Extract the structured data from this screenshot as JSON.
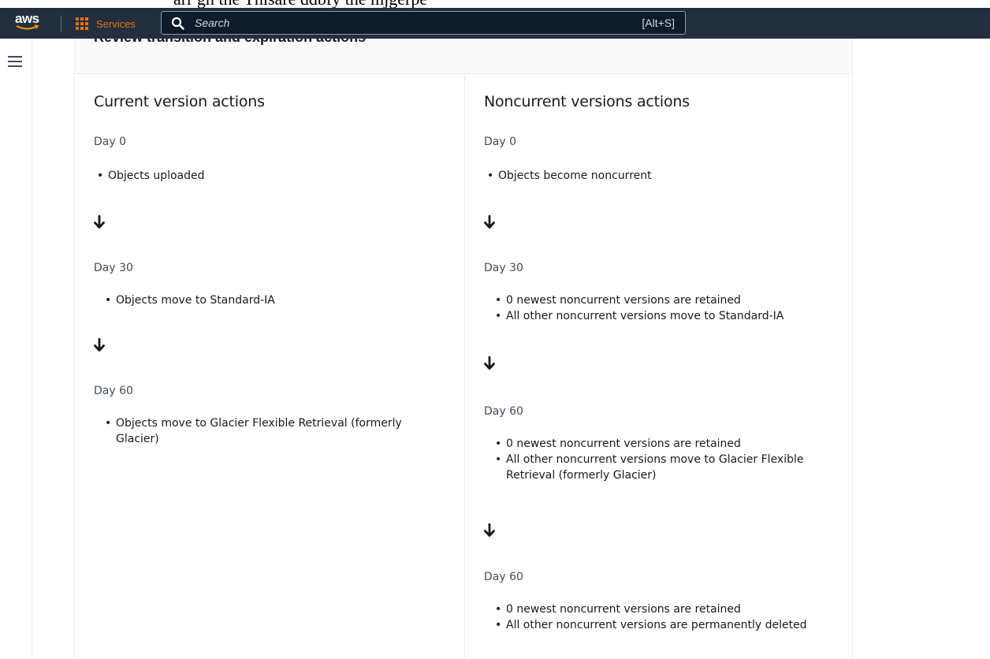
{
  "doc_strip_text": "arr gh  the   Thisare   ddbfy  the  mjgerpe",
  "nav": {
    "logo_text": "aws",
    "services_label": "Services",
    "search_placeholder": "Search",
    "search_shortcut": "[Alt+S]"
  },
  "panel": {
    "title": "Review transition and expiration actions"
  },
  "current": {
    "title": "Current version actions",
    "steps": [
      {
        "day": "Day 0",
        "items": [
          "Objects uploaded"
        ]
      },
      {
        "day": "Day 30",
        "items": [
          "Objects move to Standard-IA"
        ]
      },
      {
        "day": "Day 60",
        "items": [
          "Objects move to Glacier Flexible Retrieval (formerly Glacier)"
        ]
      }
    ]
  },
  "noncurrent": {
    "title": "Noncurrent versions actions",
    "steps": [
      {
        "day": "Day 0",
        "items": [
          "Objects become noncurrent"
        ]
      },
      {
        "day": "Day 30",
        "items": [
          "0 newest noncurrent versions are retained",
          "All other noncurrent versions move to Standard-IA"
        ]
      },
      {
        "day": "Day 60",
        "items": [
          "0 newest noncurrent versions are retained",
          "All other noncurrent versions move to Glacier Flexible Retrieval (formerly Glacier)"
        ]
      },
      {
        "day": "Day 60",
        "items": [
          "0 newest noncurrent versions are retained",
          "All other noncurrent versions are permanently deleted"
        ]
      }
    ]
  },
  "arrow_glyph": "🡣",
  "colors": {
    "nav_bg": "#232f3e",
    "accent": "#ec7211"
  }
}
